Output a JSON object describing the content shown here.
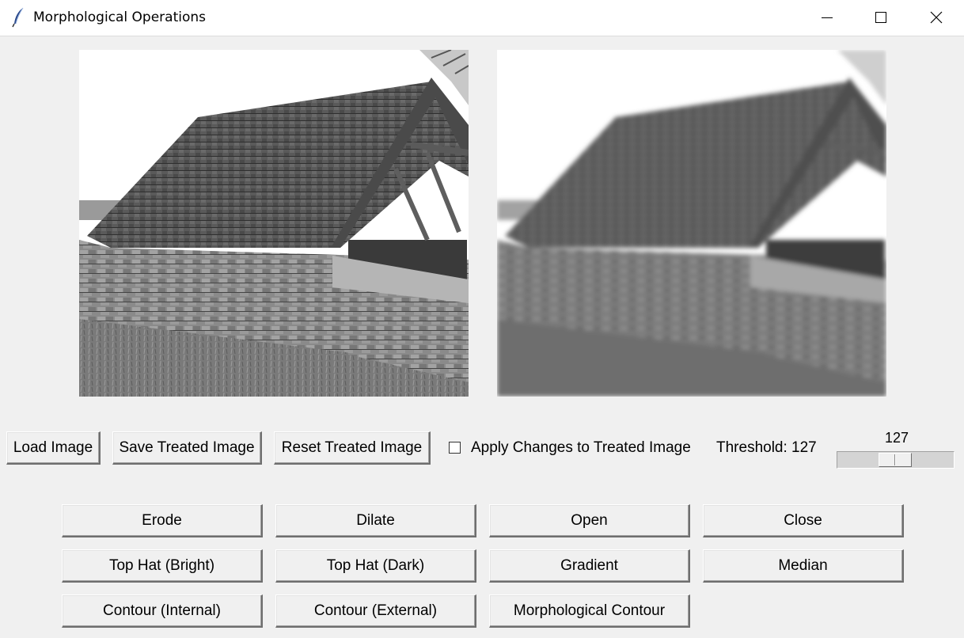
{
  "window": {
    "title": "Morphological Operations",
    "icon": "feather-icon",
    "controls": [
      "minimize-icon",
      "maximize-icon",
      "close-icon"
    ]
  },
  "images": {
    "original": "Original image (grayscale stone barn with tiled roof)",
    "treated": "Treated image (blurred grayscale stone barn)"
  },
  "toolbar": {
    "load_label": "Load Image",
    "save_label": "Save Treated Image",
    "reset_label": "Reset Treated Image",
    "apply_label": "Apply Changes to Treated Image",
    "apply_checked": false,
    "threshold_label": "Threshold: 127"
  },
  "scale": {
    "value": "127",
    "min": 0,
    "max": 255,
    "current": 127
  },
  "operations": {
    "row1": [
      "Erode",
      "Dilate",
      "Open",
      "Close"
    ],
    "row2": [
      "Top Hat (Bright)",
      "Top Hat (Dark)",
      "Gradient",
      "Median"
    ],
    "row3": [
      "Contour (Internal)",
      "Contour (External)",
      "Morphological Contour"
    ]
  }
}
